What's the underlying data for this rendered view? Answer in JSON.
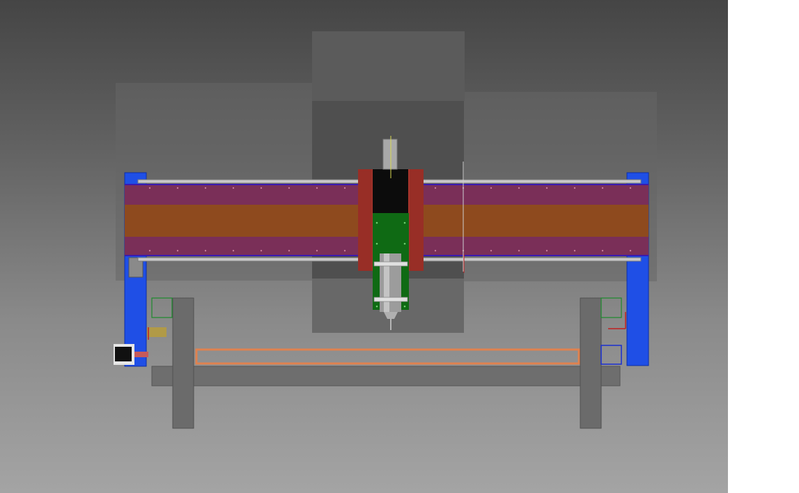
{
  "scene": {
    "subject": "cnc-router-gantry-front-view",
    "colors": {
      "background_top": "#454545",
      "background_bottom": "#a4a4a4",
      "gantry_uprights": "#1f4fe6",
      "gantry_beam_purple": "#7a2f58",
      "gantry_beam_orange": "#8e4a1e",
      "carriage_plate": "#a8352c",
      "z_block": "#0c0c0c",
      "z_plate": "#0f6a14",
      "spindle": "#9c9c9c",
      "table_frame": "#6b6b6b",
      "bed_outline": "#e0824f"
    }
  }
}
